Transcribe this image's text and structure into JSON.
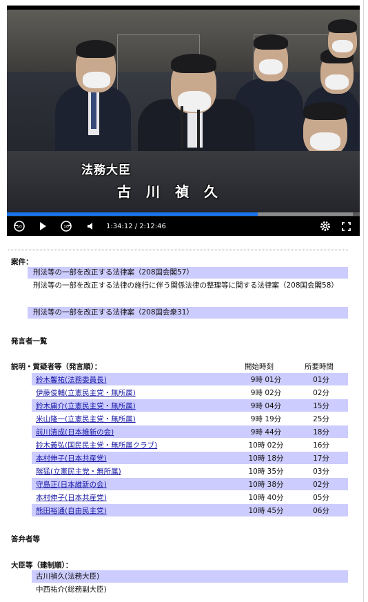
{
  "video": {
    "caption_role": "法務大臣",
    "caption_name": "古川禎久",
    "current_time": "1:34:12",
    "separator": "/",
    "duration": "2:12:46",
    "progress_fraction": 0.71,
    "buffer_fraction": 0.98,
    "accent_color": "#1a73e8"
  },
  "agenda": {
    "label": "案件：",
    "bills": [
      {
        "text": "刑法等の一部を改正する法律案（208国会閣57）",
        "highlight": true
      },
      {
        "text": "刑法等の一部を改正する法律の施行に伴う関係法律の整理等に関する法律案（208国会閣58）",
        "highlight": false
      },
      {
        "text": "刑法等の一部を改正する法律案（208国会衆31）",
        "highlight": true
      }
    ]
  },
  "speakers": {
    "section_label": "発言者一覧",
    "subheading": "説明・質疑者等（発言順）：",
    "col_start": "開始時刻",
    "col_duration": "所要時間",
    "rows": [
      {
        "name": "鈴木馨祐(法務委員長)",
        "start": "9時 01分",
        "duration": "01分"
      },
      {
        "name": "伊藤俊輔(立憲民主党・無所属)",
        "start": "9時 02分",
        "duration": "02分"
      },
      {
        "name": "鈴木庸介(立憲民主党・無所属)",
        "start": "9時 04分",
        "duration": "15分"
      },
      {
        "name": "米山隆一(立憲民主党・無所属)",
        "start": "9時 19分",
        "duration": "25分"
      },
      {
        "name": "前川清成(日本維新の会)",
        "start": "9時 44分",
        "duration": "18分"
      },
      {
        "name": "鈴木義弘(国民民主党・無所属クラブ)",
        "start": "10時 02分",
        "duration": "16分"
      },
      {
        "name": "本村伸子(日本共産党)",
        "start": "10時 18分",
        "duration": "17分"
      },
      {
        "name": "階猛(立憲民主党・無所属)",
        "start": "10時 35分",
        "duration": "03分"
      },
      {
        "name": "守島正(日本維新の会)",
        "start": "10時 38分",
        "duration": "02分"
      },
      {
        "name": "本村伸子(日本共産党)",
        "start": "10時 40分",
        "duration": "05分"
      },
      {
        "name": "熊田裕通(自由民主党)",
        "start": "10時 45分",
        "duration": "06分"
      }
    ]
  },
  "answerers": {
    "section_label": "答弁者等",
    "subheading": "大臣等（建制順）：",
    "ministers": [
      {
        "name": "古川禎久(法務大臣)"
      },
      {
        "name": "中西祐介(総務副大臣)"
      }
    ]
  },
  "colors": {
    "row_highlight": "#ccccff",
    "link": "#1a1aa6"
  },
  "icons": [
    "replay-10-icon",
    "play-icon",
    "forward-10-icon",
    "volume-icon",
    "settings-gear-icon",
    "fullscreen-icon"
  ]
}
